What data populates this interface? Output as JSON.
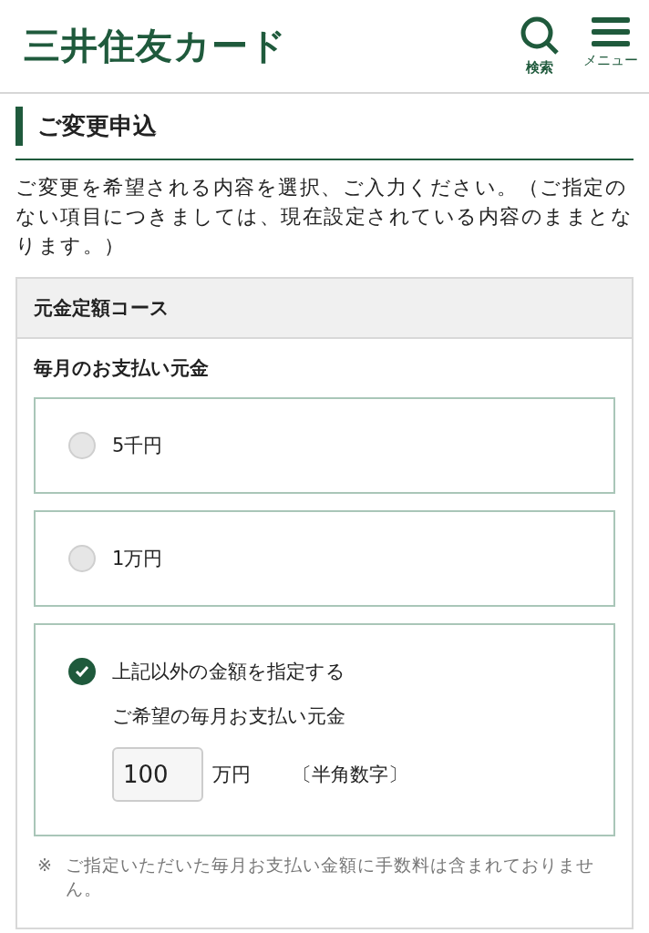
{
  "header": {
    "logo": "三井住友カード",
    "search_label": "検索",
    "menu_label": "メニュー"
  },
  "page_title": "ご変更申込",
  "intro": "ご変更を希望される内容を選択、ご入力ください。（ご指定のない項目につきましては、現在設定されている内容のままとなります。）",
  "panel": {
    "title": "元金定額コース",
    "field_label": "毎月のお支払い元金",
    "options": [
      {
        "label": "5千円",
        "selected": false
      },
      {
        "label": "1万円",
        "selected": false
      },
      {
        "label": "上記以外の金額を指定する",
        "selected": true,
        "detail": {
          "label": "ご希望の毎月お支払い元金",
          "value": "100",
          "unit": "万円",
          "hint": "〔半角数字〕"
        }
      }
    ],
    "note_mark": "※",
    "note": "ご指定いただいた毎月お支払い金額に手数料は含まれておりません。"
  }
}
